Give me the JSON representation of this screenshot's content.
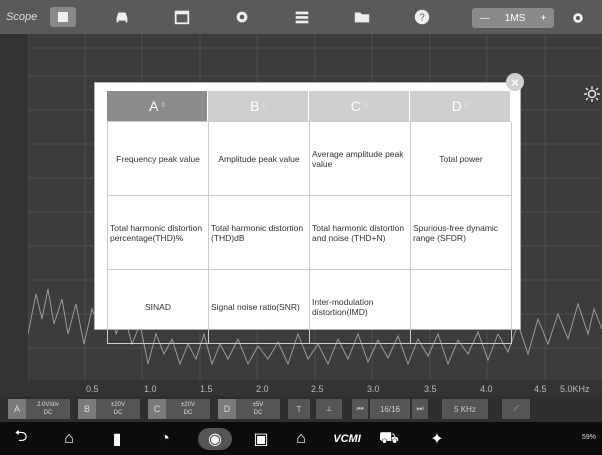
{
  "toolbar": {
    "app_label": "Scope",
    "icons": [
      "stop-icon",
      "car-icon",
      "calendar-icon",
      "gear-icon",
      "grid-icon",
      "folder-icon",
      "help-icon"
    ],
    "time_minus": "—",
    "time_value": "1MS",
    "time_plus": "+"
  },
  "plot": {
    "y_ticks": [
      "",
      "",
      "",
      "",
      "",
      "",
      "",
      "",
      "",
      "",
      "",
      ""
    ],
    "x_ticks": [
      "0.5",
      "1.0",
      "1.5",
      "2.0",
      "2.5",
      "3.0",
      "3.5",
      "4.0",
      "4.5",
      "5.0KHz"
    ]
  },
  "channels": [
    {
      "letter": "A",
      "line1": "2.0V/div",
      "line2": "DC"
    },
    {
      "letter": "B",
      "line1": "±20V",
      "line2": "DC"
    },
    {
      "letter": "C",
      "line1": "±20V",
      "line2": "DC"
    },
    {
      "letter": "D",
      "line1": "±5V",
      "line2": "DC"
    }
  ],
  "controls": {
    "page": "16/16",
    "freq": "5 KHz"
  },
  "nav": {
    "vcm_label": "VCMI",
    "status": "59%"
  },
  "dialog": {
    "tabs": [
      {
        "label": "A",
        "sub": "0"
      },
      {
        "label": "B",
        "sub": "0"
      },
      {
        "label": "C",
        "sub": "0"
      },
      {
        "label": "D",
        "sub": "0"
      }
    ],
    "close": "×",
    "cells": [
      {
        "text": "Frequency peak value",
        "center": true
      },
      {
        "text": "Amplitude peak value",
        "center": true
      },
      {
        "text": "Average amplitude peak value",
        "center": false
      },
      {
        "text": "Total power",
        "center": true
      },
      {
        "text": "Total harmonic distortion percentage(THD)%",
        "center": false
      },
      {
        "text": "Total harmonic distortion (THD)dB",
        "center": false
      },
      {
        "text": "Total harmonic distortion and noise (THD+N)",
        "center": false
      },
      {
        "text": "Spurious-free dynamic range (SFDR)",
        "center": false
      },
      {
        "text": "SINAD",
        "center": true
      },
      {
        "text": "Signal noise ratio(SNR)",
        "center": false
      },
      {
        "text": "Inter-modulation distortion(IMD)",
        "center": false
      },
      {
        "text": "",
        "center": true
      }
    ]
  }
}
